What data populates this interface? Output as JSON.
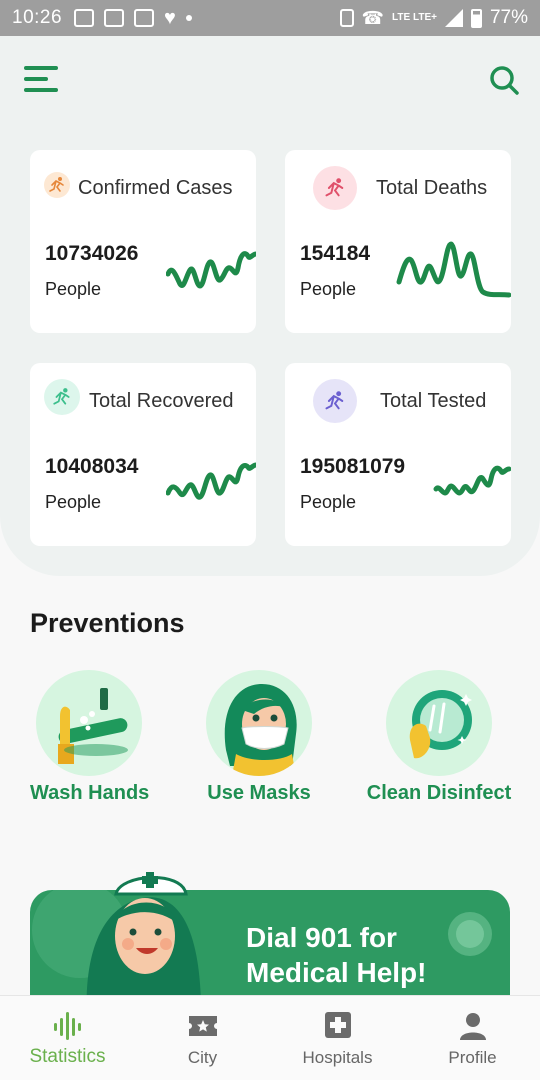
{
  "status_bar": {
    "time": "10:26",
    "network_label": "LTE LTE+",
    "battery": "77%"
  },
  "header": {
    "menu_icon": "hamburger-menu-icon",
    "search_icon": "search-icon"
  },
  "stats": [
    {
      "title": "Confirmed Cases",
      "value": "10734026",
      "unit": "People",
      "icon": "running-person-icon",
      "badge_color": "#fde8d3",
      "icon_color": "#e6873a"
    },
    {
      "title": "Total Deaths",
      "value": "154184",
      "unit": "People",
      "icon": "running-person-icon",
      "badge_color": "#fde0e4",
      "icon_color": "#e0506a"
    },
    {
      "title": "Total Recovered",
      "value": "10408034",
      "unit": "People",
      "icon": "running-person-icon",
      "badge_color": "#ddf6ec",
      "icon_color": "#3cbf8c"
    },
    {
      "title": "Total Tested",
      "value": "195081079",
      "unit": "People",
      "icon": "running-person-icon",
      "badge_color": "#e6e4f8",
      "icon_color": "#6b5fd0"
    }
  ],
  "preventions": {
    "title": "Preventions",
    "items": [
      {
        "label": "Wash Hands",
        "icon": "wash-hands-illustration"
      },
      {
        "label": "Use Masks",
        "icon": "face-mask-illustration"
      },
      {
        "label": "Clean Disinfect",
        "icon": "clean-disinfect-illustration"
      }
    ]
  },
  "banner": {
    "line1": "Dial 901 for",
    "line2": "Medical Help!"
  },
  "bottom_nav": [
    {
      "label": "Statistics",
      "icon": "statistics-icon",
      "active": true
    },
    {
      "label": "City",
      "icon": "city-ticket-icon",
      "active": false
    },
    {
      "label": "Hospitals",
      "icon": "hospital-cross-icon",
      "active": false
    },
    {
      "label": "Profile",
      "icon": "profile-person-icon",
      "active": false
    }
  ],
  "colors": {
    "accent": "#1f8f52",
    "sparkline": "#1e8a4a",
    "nav_active": "#6ab04c",
    "banner": "#2e9a62"
  }
}
